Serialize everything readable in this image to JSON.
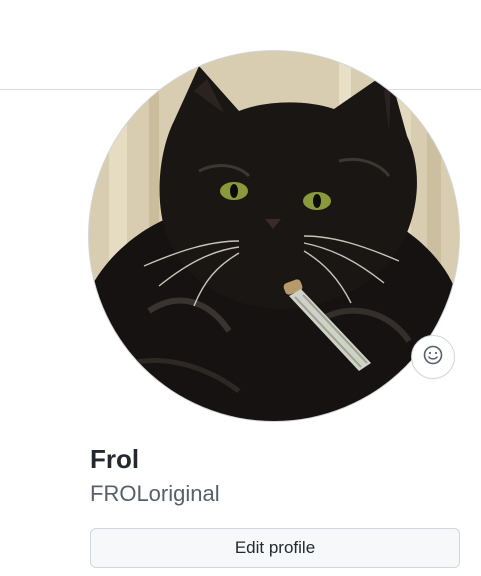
{
  "profile": {
    "display_name": "Frol",
    "username": "FROLoriginal",
    "avatar_alt": "black cat avatar",
    "status_icon": "smiley-icon"
  },
  "actions": {
    "edit_profile_label": "Edit profile"
  },
  "colors": {
    "name_text": "#24292f",
    "username_text": "#57606a",
    "button_bg": "#f6f8fa",
    "border": "#d0d7de"
  }
}
